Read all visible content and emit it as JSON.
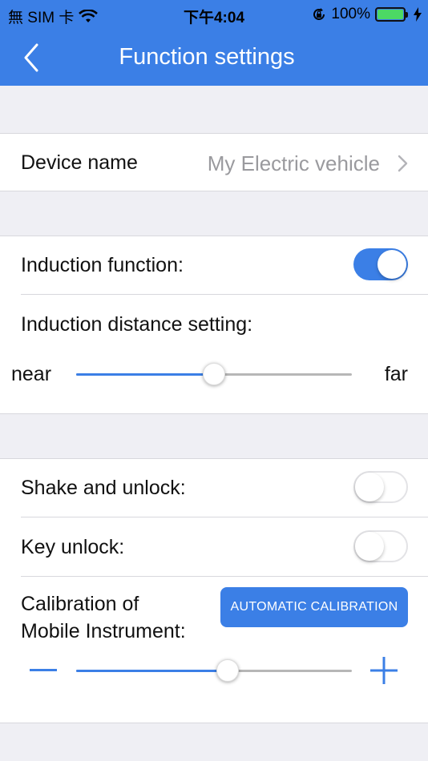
{
  "status_bar": {
    "carrier": "無 SIM 卡",
    "time": "下午4:04",
    "battery_percent": "100%",
    "battery_level": 1.0,
    "icons": [
      "wifi-icon",
      "orientation-lock-icon",
      "battery-icon",
      "charging-icon"
    ]
  },
  "nav": {
    "title": "Function settings",
    "back_icon": "chevron-left-icon"
  },
  "device": {
    "label": "Device name",
    "value": "My Electric vehicle"
  },
  "induction": {
    "function_label": "Induction function:",
    "enabled": true,
    "distance_label": "Induction distance setting:",
    "near_label": "near",
    "far_label": "far",
    "distance_level": 0.5
  },
  "shake": {
    "label": "Shake and unlock:",
    "enabled": false
  },
  "key_unlock": {
    "label": "Key unlock:",
    "enabled": false
  },
  "calibration": {
    "label_line1": "Calibration of",
    "label_line2": "Mobile Instrument:",
    "button_label": "AUTOMATIC CALIBRATION",
    "minus_icon": "minus-icon",
    "plus_icon": "plus-icon",
    "level": 0.55
  },
  "colors": {
    "accent": "#3b7fe6",
    "background": "#efeff4",
    "toggle_on": "#3b7fe6",
    "battery": "#4cd964"
  }
}
